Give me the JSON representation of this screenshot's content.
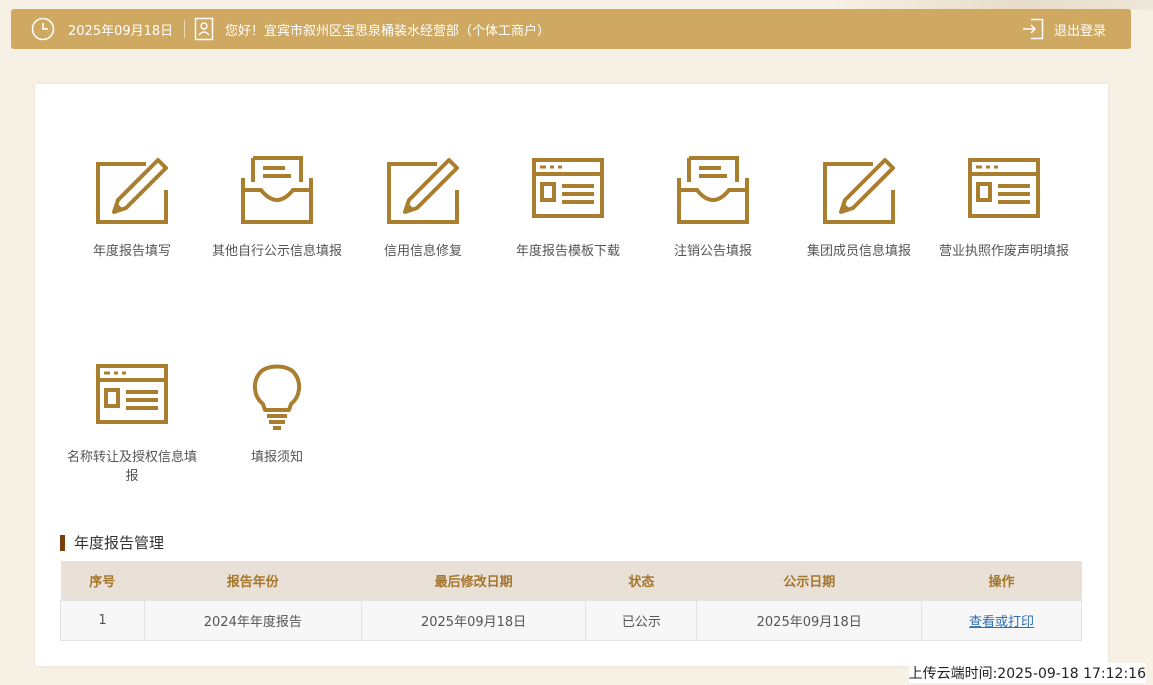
{
  "header": {
    "date": "2025年09月18日",
    "greeting": "您好！宜宾市叙州区宝思泉桶装水经营部（个体工商户）",
    "logout_label": "退出登录",
    "icons": [
      "clock-icon",
      "user-card-icon",
      "logout-icon"
    ]
  },
  "tiles": [
    {
      "label": "年度报告填写",
      "icon": "edit-pencil-icon"
    },
    {
      "label": "其他自行公示信息填报",
      "icon": "inbox-document-icon"
    },
    {
      "label": "信用信息修复",
      "icon": "edit-pencil-icon"
    },
    {
      "label": "年度报告模板下载",
      "icon": "browser-window-icon"
    },
    {
      "label": "注销公告填报",
      "icon": "inbox-document-icon"
    },
    {
      "label": "集团成员信息填报",
      "icon": "edit-pencil-icon"
    },
    {
      "label": "营业执照作废声明填报",
      "icon": "browser-window-icon"
    },
    {
      "label": "名称转让及授权信息填报",
      "icon": "browser-window-icon"
    },
    {
      "label": "填报须知",
      "icon": "lightbulb-icon"
    }
  ],
  "section_title": "年度报告管理",
  "table": {
    "headers": [
      "序号",
      "报告年份",
      "最后修改日期",
      "状态",
      "公示日期",
      "操作"
    ],
    "rows": [
      {
        "index": "1",
        "year": "2024年年度报告",
        "modified": "2025年09月18日",
        "status": "已公示",
        "published": "2025年09月18日",
        "action": "查看或打印"
      }
    ]
  },
  "upload_time": "上传云端时间:2025-09-18 17:12:16",
  "colors": {
    "accent": "#cfa862",
    "icon": "#a97f2f",
    "header_text": "#a5752c",
    "section_bar": "#7a3f0c",
    "link": "#2f6fb3"
  }
}
